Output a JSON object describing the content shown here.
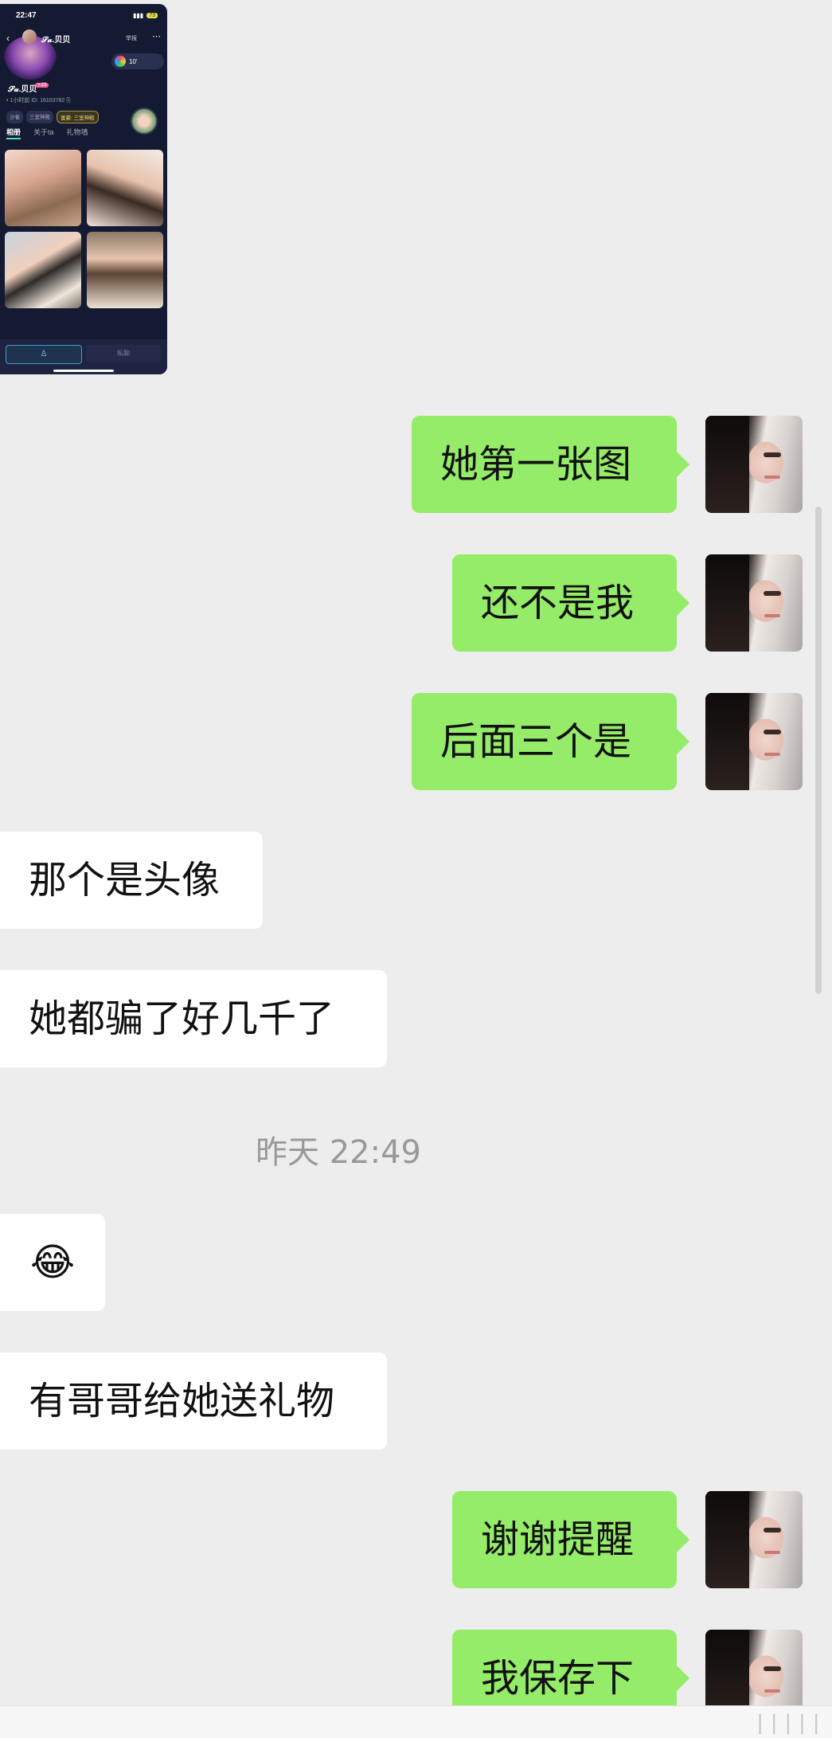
{
  "shared_screenshot": {
    "status_time": "22:47",
    "battery": "73",
    "profile_name": "𝓢𝓪.贝贝",
    "report_label": "举报",
    "music_label": "10'",
    "name_line": "𝓢𝓪.贝贝",
    "age_tag": "♀23",
    "id_line": "• 1小时前  ID: 16103782  ⎘",
    "chips": [
      "沙雀",
      "三室神殿",
      "富豪: 三室神殿"
    ],
    "tabs": [
      "相册",
      "关于ta",
      "礼物墙"
    ],
    "bottom_left_icon": "person-icon",
    "bottom_right_label": "私聊"
  },
  "messages": [
    {
      "side": "me",
      "text": "她第一张图"
    },
    {
      "side": "me",
      "text": "还不是我"
    },
    {
      "side": "me",
      "text": "后面三个是"
    },
    {
      "side": "them",
      "text": "那个是头像"
    },
    {
      "side": "them",
      "text": "她都骗了好几千了"
    },
    {
      "side": "them",
      "text": "😂"
    },
    {
      "side": "them",
      "text": "有哥哥给她送礼物"
    },
    {
      "side": "me",
      "text": "谢谢提醒"
    },
    {
      "side": "me",
      "text": "我保存下"
    }
  ],
  "timestamp": "昨天 22:49",
  "bottom_indicator": "|||||"
}
